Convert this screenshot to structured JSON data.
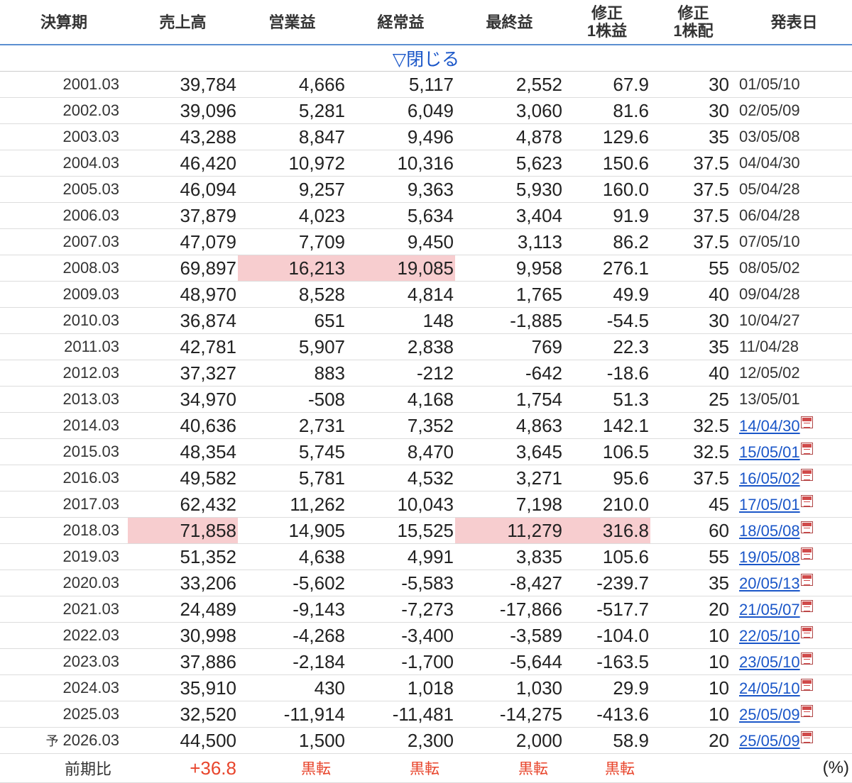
{
  "headers": [
    [
      "決算期"
    ],
    [
      "売上高"
    ],
    [
      "営業益"
    ],
    [
      "経常益"
    ],
    [
      "最終益"
    ],
    [
      "修正",
      "1株益"
    ],
    [
      "修正",
      "1株配"
    ],
    [
      "発表日"
    ]
  ],
  "toggle_label": "▽閉じる",
  "forecast_mark": "予",
  "rows": [
    {
      "period": "2001.03",
      "sales": "39,784",
      "op": "4,666",
      "ord": "5,117",
      "net": "2,552",
      "eps": "67.9",
      "div": "30",
      "date": "01/05/10",
      "link": false
    },
    {
      "period": "2002.03",
      "sales": "39,096",
      "op": "5,281",
      "ord": "6,049",
      "net": "3,060",
      "eps": "81.6",
      "div": "30",
      "date": "02/05/09",
      "link": false
    },
    {
      "period": "2003.03",
      "sales": "43,288",
      "op": "8,847",
      "ord": "9,496",
      "net": "4,878",
      "eps": "129.6",
      "div": "35",
      "date": "03/05/08",
      "link": false
    },
    {
      "period": "2004.03",
      "sales": "46,420",
      "op": "10,972",
      "ord": "10,316",
      "net": "5,623",
      "eps": "150.6",
      "div": "37.5",
      "date": "04/04/30",
      "link": false
    },
    {
      "period": "2005.03",
      "sales": "46,094",
      "op": "9,257",
      "ord": "9,363",
      "net": "5,930",
      "eps": "160.0",
      "div": "37.5",
      "date": "05/04/28",
      "link": false
    },
    {
      "period": "2006.03",
      "sales": "37,879",
      "op": "4,023",
      "ord": "5,634",
      "net": "3,404",
      "eps": "91.9",
      "div": "37.5",
      "date": "06/04/28",
      "link": false
    },
    {
      "period": "2007.03",
      "sales": "47,079",
      "op": "7,709",
      "ord": "9,450",
      "net": "3,113",
      "eps": "86.2",
      "div": "37.5",
      "date": "07/05/10",
      "link": false
    },
    {
      "period": "2008.03",
      "sales": "69,897",
      "op": "16,213",
      "ord": "19,085",
      "net": "9,958",
      "eps": "276.1",
      "div": "55",
      "date": "08/05/02",
      "link": false,
      "highlight": [
        "op",
        "ord"
      ]
    },
    {
      "period": "2009.03",
      "sales": "48,970",
      "op": "8,528",
      "ord": "4,814",
      "net": "1,765",
      "eps": "49.9",
      "div": "40",
      "date": "09/04/28",
      "link": false
    },
    {
      "period": "2010.03",
      "sales": "36,874",
      "op": "651",
      "ord": "148",
      "net": "-1,885",
      "eps": "-54.5",
      "div": "30",
      "date": "10/04/27",
      "link": false
    },
    {
      "period": "2011.03",
      "sales": "42,781",
      "op": "5,907",
      "ord": "2,838",
      "net": "769",
      "eps": "22.3",
      "div": "35",
      "date": "11/04/28",
      "link": false
    },
    {
      "period": "2012.03",
      "sales": "37,327",
      "op": "883",
      "ord": "-212",
      "net": "-642",
      "eps": "-18.6",
      "div": "40",
      "date": "12/05/02",
      "link": false
    },
    {
      "period": "2013.03",
      "sales": "34,970",
      "op": "-508",
      "ord": "4,168",
      "net": "1,754",
      "eps": "51.3",
      "div": "25",
      "date": "13/05/01",
      "link": false
    },
    {
      "period": "2014.03",
      "sales": "40,636",
      "op": "2,731",
      "ord": "7,352",
      "net": "4,863",
      "eps": "142.1",
      "div": "32.5",
      "date": "14/04/30",
      "link": true
    },
    {
      "period": "2015.03",
      "sales": "48,354",
      "op": "5,745",
      "ord": "8,470",
      "net": "3,645",
      "eps": "106.5",
      "div": "32.5",
      "date": "15/05/01",
      "link": true
    },
    {
      "period": "2016.03",
      "sales": "49,582",
      "op": "5,781",
      "ord": "4,532",
      "net": "3,271",
      "eps": "95.6",
      "div": "37.5",
      "date": "16/05/02",
      "link": true
    },
    {
      "period": "2017.03",
      "sales": "62,432",
      "op": "11,262",
      "ord": "10,043",
      "net": "7,198",
      "eps": "210.0",
      "div": "45",
      "date": "17/05/01",
      "link": true
    },
    {
      "period": "2018.03",
      "sales": "71,858",
      "op": "14,905",
      "ord": "15,525",
      "net": "11,279",
      "eps": "316.8",
      "div": "60",
      "date": "18/05/08",
      "link": true,
      "highlight": [
        "sales",
        "net",
        "eps"
      ]
    },
    {
      "period": "2019.03",
      "sales": "51,352",
      "op": "4,638",
      "ord": "4,991",
      "net": "3,835",
      "eps": "105.6",
      "div": "55",
      "date": "19/05/08",
      "link": true
    },
    {
      "period": "2020.03",
      "sales": "33,206",
      "op": "-5,602",
      "ord": "-5,583",
      "net": "-8,427",
      "eps": "-239.7",
      "div": "35",
      "date": "20/05/13",
      "link": true
    },
    {
      "period": "2021.03",
      "sales": "24,489",
      "op": "-9,143",
      "ord": "-7,273",
      "net": "-17,866",
      "eps": "-517.7",
      "div": "20",
      "date": "21/05/07",
      "link": true
    },
    {
      "period": "2022.03",
      "sales": "30,998",
      "op": "-4,268",
      "ord": "-3,400",
      "net": "-3,589",
      "eps": "-104.0",
      "div": "10",
      "date": "22/05/10",
      "link": true
    },
    {
      "period": "2023.03",
      "sales": "37,886",
      "op": "-2,184",
      "ord": "-1,700",
      "net": "-5,644",
      "eps": "-163.5",
      "div": "10",
      "date": "23/05/10",
      "link": true
    },
    {
      "period": "2024.03",
      "sales": "35,910",
      "op": "430",
      "ord": "1,018",
      "net": "1,030",
      "eps": "29.9",
      "div": "10",
      "date": "24/05/10",
      "link": true
    },
    {
      "period": "2025.03",
      "sales": "32,520",
      "op": "-11,914",
      "ord": "-11,481",
      "net": "-14,275",
      "eps": "-413.6",
      "div": "10",
      "date": "25/05/09",
      "link": true
    },
    {
      "period": "2026.03",
      "sales": "44,500",
      "op": "1,500",
      "ord": "2,300",
      "net": "2,000",
      "eps": "58.9",
      "div": "20",
      "date": "25/05/09",
      "link": true,
      "forecast": true
    }
  ],
  "compare": {
    "label": "前期比",
    "sales": "+36.8",
    "op": "黒転",
    "ord": "黒転",
    "net": "黒転",
    "eps": "黒転",
    "unit": "(%)"
  },
  "colors": {
    "header_rule": "#5b8fd0",
    "highlight": "#f7cdcf",
    "link": "#1a56c8",
    "increase": "#e8452c"
  },
  "icons": {
    "date_link": "pdf-icon"
  }
}
